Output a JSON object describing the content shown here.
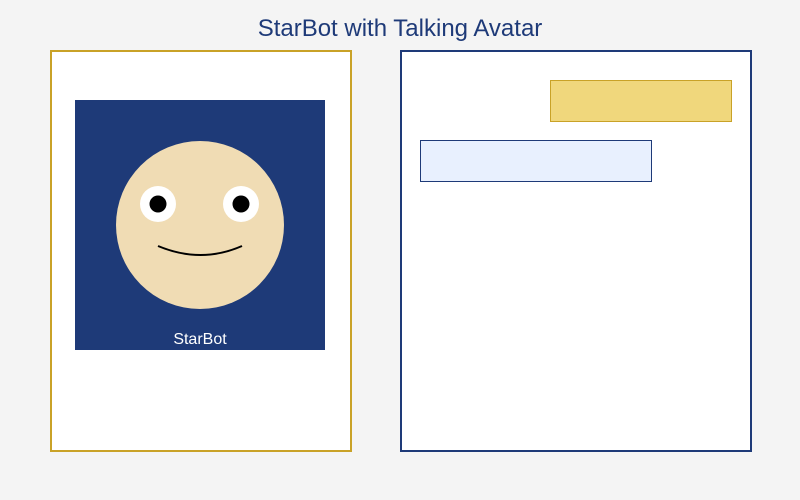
{
  "page": {
    "title": "StarBot with Talking Avatar"
  },
  "avatar": {
    "name": "StarBot",
    "icons": [
      "face-icon",
      "eye-icon",
      "pupil-icon",
      "mouth-icon"
    ],
    "colors": {
      "panel_border": "#c9a227",
      "stage_background": "#1e3a78",
      "face": "#f0dcb4",
      "eye_white": "#ffffff",
      "pupil": "#000000"
    }
  },
  "chat": {
    "messages": [
      {
        "role": "user",
        "text": ""
      },
      {
        "role": "bot",
        "text": ""
      }
    ],
    "colors": {
      "panel_border": "#1e3a78",
      "user_bubble": "#f0d77c",
      "user_bubble_border": "#c9a227",
      "bot_bubble": "#e8f0fe",
      "bot_bubble_border": "#1e3a78"
    }
  }
}
